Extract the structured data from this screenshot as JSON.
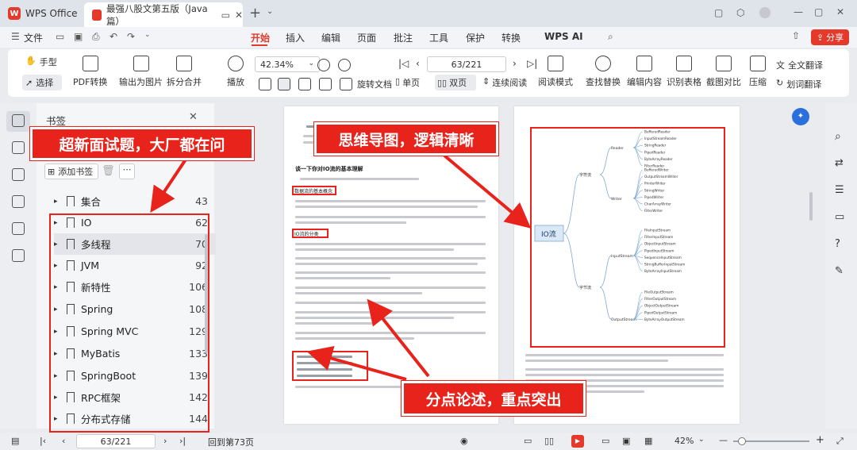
{
  "titlebar": {
    "app_name": "WPS Office",
    "doc_tab": "最强八股文第五版（Java篇）",
    "plus": "+"
  },
  "menubar": {
    "file": "文件",
    "tabs": [
      "开始",
      "插入",
      "编辑",
      "页面",
      "批注",
      "工具",
      "保护",
      "转换",
      "WPS AI"
    ],
    "share": "分享"
  },
  "toolbar": {
    "hand": "手型",
    "select": "选择",
    "pdf_convert": "PDF转换",
    "export_image": "输出为图片",
    "split_merge": "拆分合并",
    "play": "播放",
    "zoom": "42.34%",
    "page": "63/221",
    "rotate": "旋转文档",
    "single": "单页",
    "double": "双页",
    "continuous": "连续阅读",
    "read_mode": "阅读模式",
    "find_replace": "查找替换",
    "edit_content": "编辑内容",
    "recognize_table": "识别表格",
    "screenshot_compare": "截图对比",
    "compress": "压缩",
    "full_translate": "全文翻译",
    "word_translate": "划词翻译"
  },
  "sidebar": {
    "title": "书签",
    "add_bookmark": "添加书签",
    "items": [
      {
        "label": "集合",
        "page": "43"
      },
      {
        "label": "IO",
        "page": "62"
      },
      {
        "label": "多线程",
        "page": "70"
      },
      {
        "label": "JVM",
        "page": "92"
      },
      {
        "label": "新特性",
        "page": "106"
      },
      {
        "label": "Spring",
        "page": "108"
      },
      {
        "label": "Spring MVC",
        "page": "129"
      },
      {
        "label": "MyBatis",
        "page": "133"
      },
      {
        "label": "SpringBoot",
        "page": "139"
      },
      {
        "label": "RPC框架",
        "page": "142"
      },
      {
        "label": "分布式存储",
        "page": "144"
      }
    ]
  },
  "callouts": {
    "interview": "超新面试题，大厂都在问",
    "mindmap": "思维导图，逻辑清晰",
    "points": "分点论述，重点突出"
  },
  "doc": {
    "heading": "谈一下你对IO流的基本理解",
    "section1": "数据流的基本概念",
    "section2": "IO流的分类",
    "mindmap_root": "IO流",
    "branch_char": "字符流",
    "branch_byte": "字节流",
    "reader": "Reader",
    "writer": "Writer",
    "inputstream": "InputStream",
    "outputstream": "OutputStream",
    "leaves_reader": [
      "BufferedReader",
      "InputStreamReader",
      "StringReader",
      "PipedReader",
      "ByteArrayReader",
      "FilterReader"
    ],
    "leaves_writer": [
      "BufferedWriter",
      "OutputStreamWriter",
      "PrinterWriter",
      "StringWriter",
      "PipedWriter",
      "CharArrayWriter",
      "FilterWriter"
    ],
    "leaves_in": [
      "FileInputStream",
      "FilterInputStream",
      "ObjectInputStream",
      "PipedInputStream",
      "SequenceInputStream",
      "StringBufferInputStream",
      "ByteArrayInputStream"
    ],
    "leaves_out": [
      "FileOutputStream",
      "FilterOutputStream",
      "ObjectOutputStream",
      "PipedOutputStream",
      "ByteArrayOutputStream"
    ]
  },
  "statusbar": {
    "page": "63/221",
    "back_to": "回到第73页",
    "zoom": "42%"
  }
}
